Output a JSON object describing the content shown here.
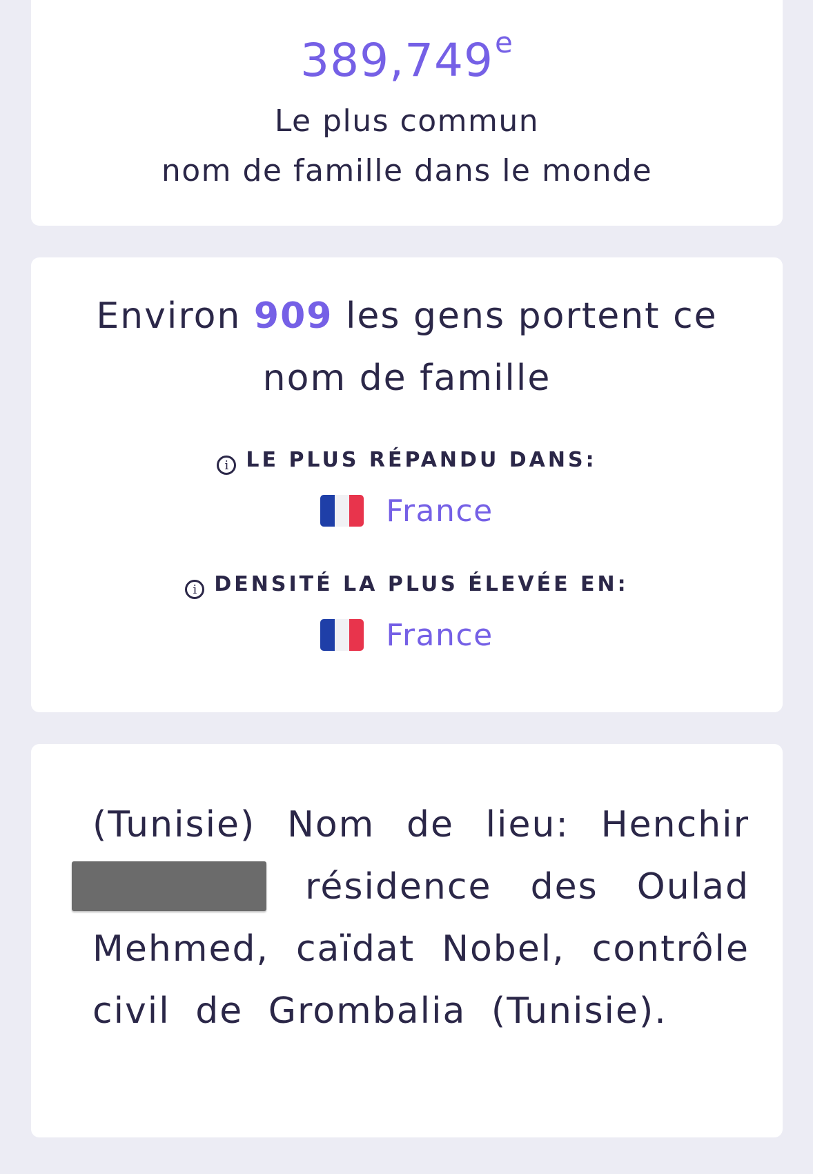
{
  "rank": {
    "value": "389,749",
    "suffix": "e",
    "line1": "Le plus commun",
    "line2": "nom de famille dans le monde"
  },
  "count": {
    "prefix": "Environ",
    "number": "909",
    "suffix": "les gens portent ce nom de famille",
    "most_common_label": "LE PLUS RÉPANDU DANS:",
    "most_common_country": "France",
    "density_label": "DENSITÉ LA PLUS ÉLEVÉE EN:",
    "density_country": "France",
    "info_icon": "info-icon",
    "flag_icon": "france-flag-icon"
  },
  "description": {
    "part1": "(Tunisie) Nom de lieu: Henchir",
    "part2": "résidence des Oulad Mehmed, caïdat Nobel, contrôle civil de Grombalia (Tunisie)."
  },
  "colors": {
    "background": "#ececf4",
    "card": "#ffffff",
    "accent": "#7560e6",
    "text": "#2b2748"
  }
}
